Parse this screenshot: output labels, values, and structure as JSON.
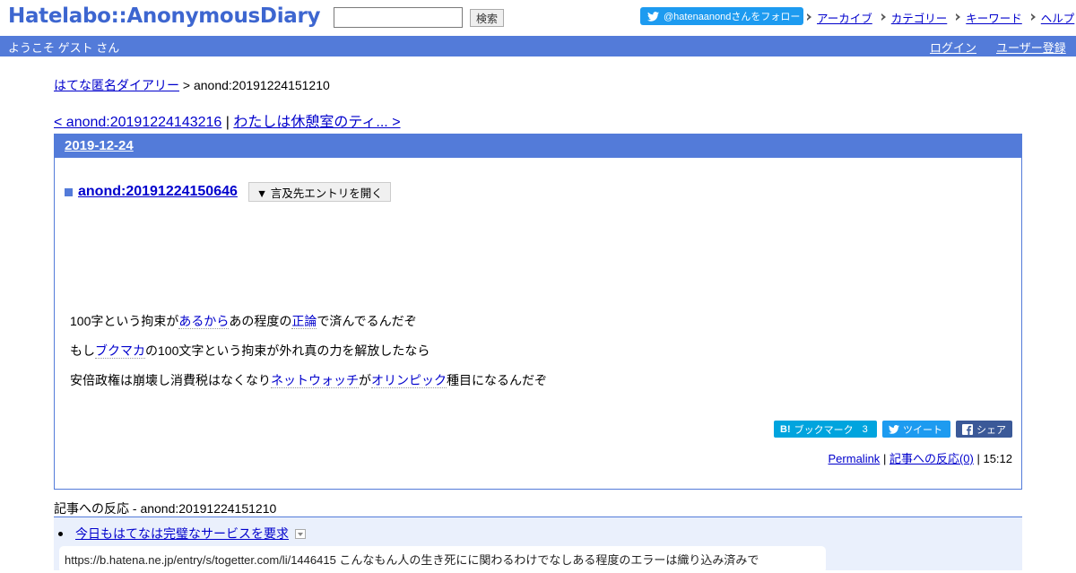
{
  "header": {
    "logo": "Hatelabo::AnonymousDiary",
    "search": {
      "value": "",
      "placeholder": "",
      "button": "検索"
    },
    "follow": "@hatenaanondさんをフォロー",
    "links": [
      "アーカイブ",
      "カテゴリー",
      "キーワード",
      "ヘルプ"
    ]
  },
  "welcome": {
    "text": "ようこそ ゲスト さん",
    "login": "ログイン",
    "signup": "ユーザー登録"
  },
  "breadcrumb": {
    "home": "はてな匿名ダイアリー",
    "separator": ">",
    "current": "anond:20191224151210"
  },
  "entry_nav": {
    "prev": "< anond:20191224143216",
    "separator": "|",
    "next": "わたしは休憩室のティ... >"
  },
  "day": {
    "date": "2019-12-24",
    "entry": {
      "title": "anond:20191224150646",
      "refer_button": "▼ 言及先エントリを開く",
      "body": {
        "line1": {
          "a": "100字という拘束が",
          "kw1": "あるから",
          "b": "あの程度の",
          "kw2": "正論",
          "c": "で済んでるんだぞ"
        },
        "line2": {
          "a": "もし",
          "kw1": "ブクマカ",
          "b": "の100文字という拘束が外れ真の力を解放したなら"
        },
        "line3": {
          "a": "安倍政権は崩壊し消費税はなくなり",
          "kw1": "ネットウォッチ",
          "b": "が",
          "kw2": "オリンピック",
          "c": "種目になるんだぞ"
        }
      },
      "share": {
        "bookmark": "ブックマーク",
        "bookmark_count": "3",
        "tweet": "ツイート",
        "facebook": "シェア"
      },
      "footer": {
        "permalink": "Permalink",
        "sep": "|",
        "reactions": "記事への反応(0)",
        "time": "| 15:12"
      }
    }
  },
  "reactions": {
    "title": "記事への反応 - anond:20191224151210",
    "items": [
      {
        "title": "今日もはてなは完璧なサービスを要求",
        "excerpt": "https://b.hatena.ne.jp/entry/s/togetter.com/li/1446415 こんなもん人の生き死にに関わるわけでなしある程度のエラーは織り込み済みで"
      }
    ]
  },
  "colors": {
    "brand": "#537bd9",
    "link": "#0000cc",
    "twitter": "#1d9bf0",
    "hatena": "#00a4de",
    "facebook": "#3b5998"
  },
  "icons": [
    "twitter-bird-icon",
    "arrow-icon",
    "square-icon",
    "hatena-bookmark-icon",
    "facebook-icon",
    "dropdown-icon"
  ]
}
